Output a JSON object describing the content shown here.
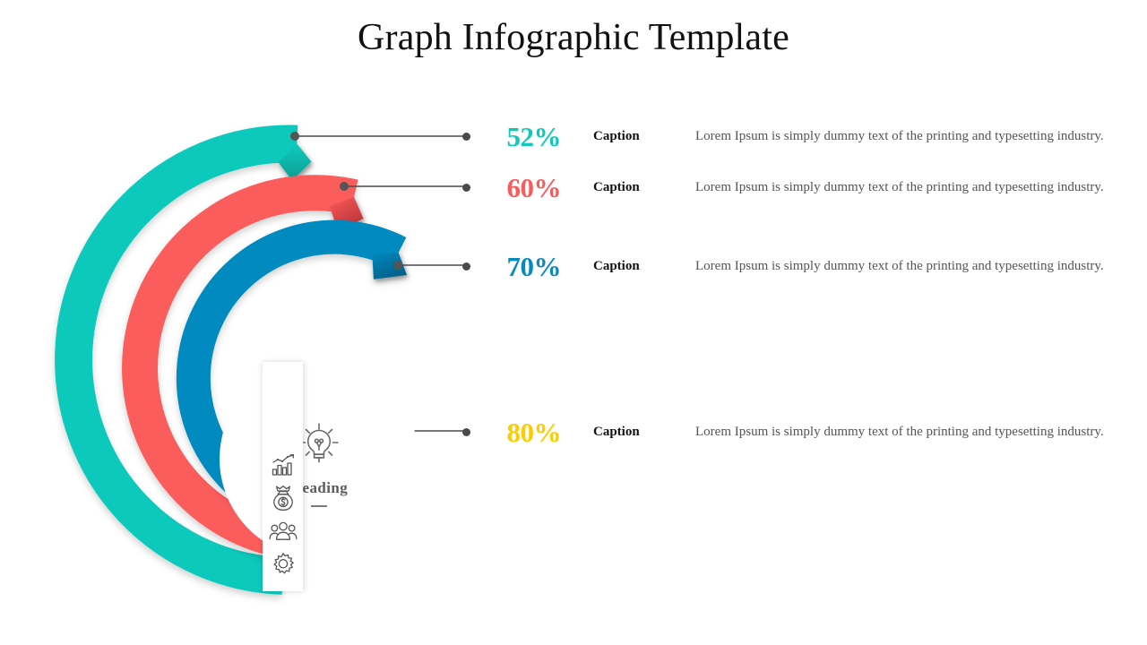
{
  "page": {
    "title": "Graph Infographic Template",
    "background": "#ffffff"
  },
  "center": {
    "icon": "lightbulb-icon",
    "heading": "Heading"
  },
  "icon_strip": {
    "icons": [
      {
        "name": "bar-chart-growth-icon",
        "label": "Growth Chart"
      },
      {
        "name": "money-bag-icon",
        "label": "Money Bag"
      },
      {
        "name": "people-group-icon",
        "label": "Team"
      },
      {
        "name": "gear-icon",
        "label": "Settings"
      }
    ]
  },
  "chart_data": {
    "type": "pie",
    "variant": "concentric-donut-gauge",
    "title": "Graph Infographic Template",
    "legend_position": "right",
    "categories": [
      "Caption",
      "Caption",
      "Caption",
      "Caption"
    ],
    "values": [
      52,
      60,
      70,
      80
    ],
    "value_labels": [
      "52%",
      "60%",
      "70%",
      "80%"
    ],
    "colors": [
      "#0FC9BC",
      "#FB5B5B",
      "#068ABF",
      "#FCCB00"
    ],
    "ylim": [
      0,
      100
    ],
    "ylabel": "",
    "xlabel": "",
    "grid": false,
    "series": [
      {
        "name": "Caption",
        "value": 52,
        "color": "#0FC9BC",
        "ring": "outer"
      },
      {
        "name": "Caption",
        "value": 60,
        "color": "#FB5B5B",
        "ring": "second"
      },
      {
        "name": "Caption",
        "value": 70,
        "color": "#068ABF",
        "ring": "third"
      },
      {
        "name": "Caption",
        "value": 80,
        "color": "#FCCB00",
        "ring": "inner"
      }
    ]
  },
  "rows": [
    {
      "percent": "52%",
      "color": "#0FC9BC",
      "caption": "Caption",
      "description": "Lorem Ipsum is simply dummy text of the printing and typesetting industry."
    },
    {
      "percent": "60%",
      "color": "#FB5B5B",
      "caption": "Caption",
      "description": "Lorem Ipsum is simply dummy text of the printing and typesetting industry."
    },
    {
      "percent": "70%",
      "color": "#068ABF",
      "caption": "Caption",
      "description": "Lorem Ipsum is simply dummy text of the printing and typesetting industry."
    },
    {
      "percent": "80%",
      "color": "#FCCB00",
      "caption": "Caption",
      "description": "Lorem Ipsum is simply dummy text of the printing and typesetting industry."
    }
  ]
}
